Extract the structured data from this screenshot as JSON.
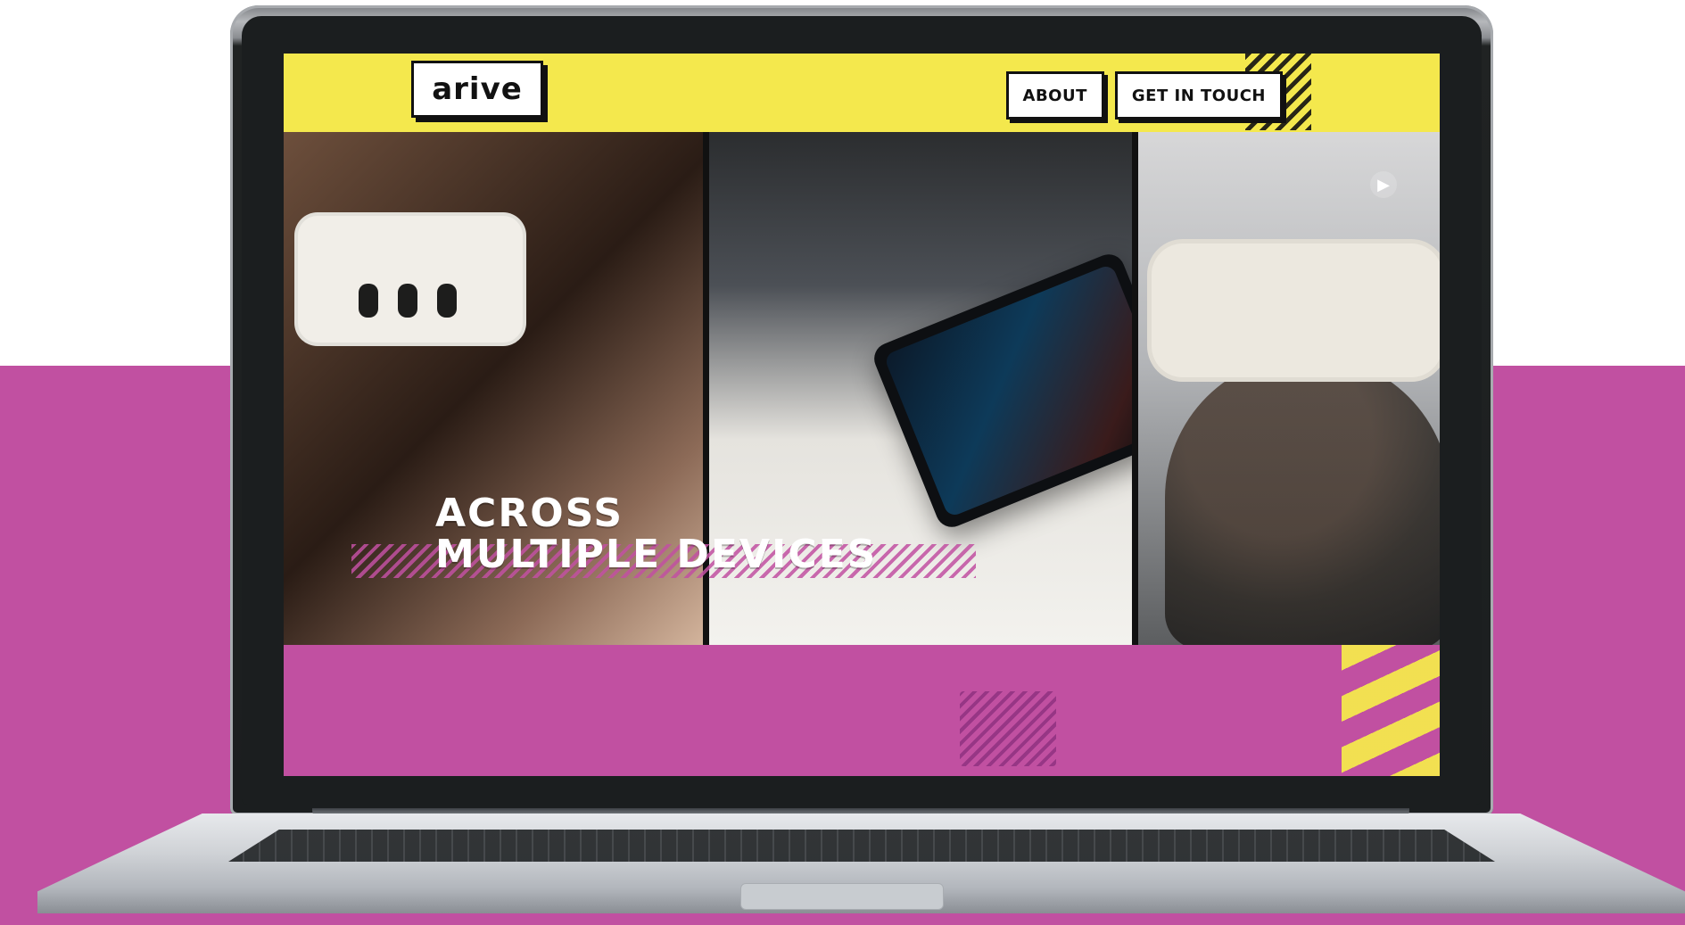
{
  "site": {
    "logo_text": "arive",
    "nav": [
      {
        "label": "ABOUT"
      },
      {
        "label": "GET IN TOUCH"
      }
    ],
    "hero": {
      "line1": "ACROSS",
      "line2": "MULTIPLE DEVICES"
    }
  },
  "colors": {
    "yellow": "#f4e84d",
    "magenta": "#c150a1",
    "dark": "#111111",
    "white": "#ffffff"
  },
  "icons": {
    "play": "play-icon"
  }
}
